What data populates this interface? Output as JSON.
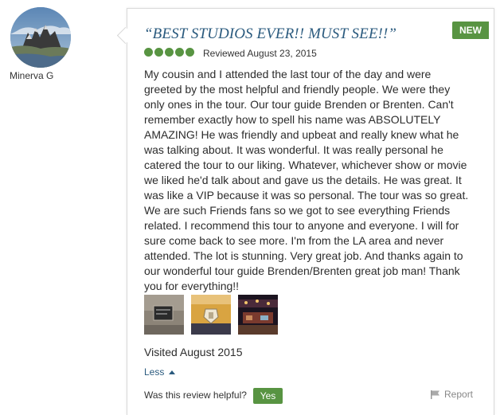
{
  "reviewer": {
    "name": "Minerva G"
  },
  "review": {
    "badge": "NEW",
    "title": "“BEST STUDIOS EVER!! MUST SEE!!”",
    "rating": 5,
    "rating_max": 5,
    "reviewed_date": "Reviewed August 23, 2015",
    "lines": [
      "My cousin and I attended the last tour of the day and were",
      "greeted by the most helpful and friendly people. We were they",
      "only ones in the tour. Our tour guide Brenden or Brenten. Can't",
      "remember exactly how to spell his name was ABSOLUTELY",
      "AMAZING! He was friendly and upbeat and really knew what he",
      "was talking about. It was wonderful. It was really personal he",
      "catered the tour to our liking. Whatever, whichever show or movie",
      "we liked he'd talk about and gave us the details. He was great. It",
      "was like a VIP because it was so personal. The tour was so great.",
      "We are such Friends fans so we got to see everything Friends",
      "related. I recommend this tour to anyone and everyone. I will for",
      "sure come back to see more. I'm from the LA area and never",
      "attended. The lot is stunning. Very great job. And thanks again to",
      "our wonderful tour guide Brenden/Brenten great job man! Thank",
      "you for everything!!"
    ],
    "photos": [
      "photo-plaque",
      "photo-sign",
      "photo-stage"
    ],
    "visited": "Visited August 2015",
    "less_label": "Less",
    "helpful_question": "Was this review helpful?",
    "yes_label": "Yes",
    "report_label": "Report"
  },
  "colors": {
    "accent_green": "#589442",
    "title_blue": "#2a5a7e"
  }
}
